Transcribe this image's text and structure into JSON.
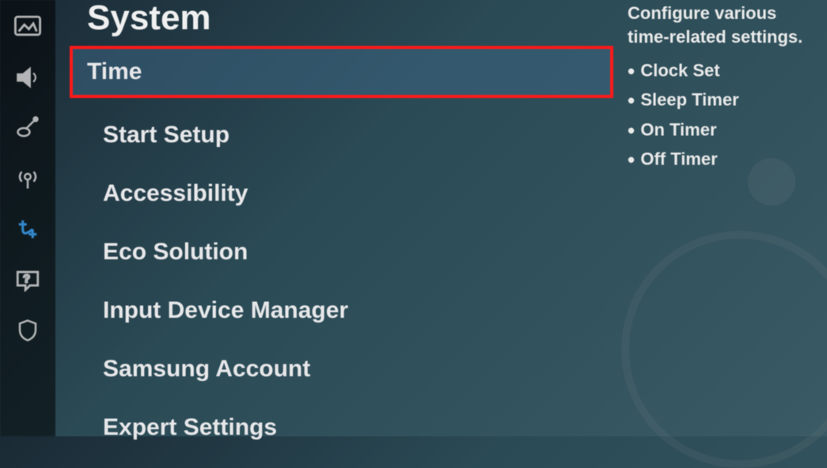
{
  "header": {
    "title": "System"
  },
  "sidebar": {
    "items": [
      {
        "name": "picture-icon"
      },
      {
        "name": "sound-icon"
      },
      {
        "name": "broadcast-icon"
      },
      {
        "name": "network-icon"
      },
      {
        "name": "system-icon",
        "active": true
      },
      {
        "name": "support-icon"
      },
      {
        "name": "privacy-icon"
      }
    ]
  },
  "menu": {
    "items": [
      {
        "label": "Time",
        "selected": true
      },
      {
        "label": "Start Setup"
      },
      {
        "label": "Accessibility"
      },
      {
        "label": "Eco Solution"
      },
      {
        "label": "Input Device Manager"
      },
      {
        "label": "Samsung Account"
      },
      {
        "label": "Expert Settings"
      }
    ]
  },
  "info": {
    "description": "Configure various time-related settings.",
    "sub_items": [
      "Clock Set",
      "Sleep Timer",
      "On Timer",
      "Off Timer"
    ]
  },
  "colors": {
    "highlight_border": "#ff1a1a",
    "active_icon": "#3a9be8"
  }
}
